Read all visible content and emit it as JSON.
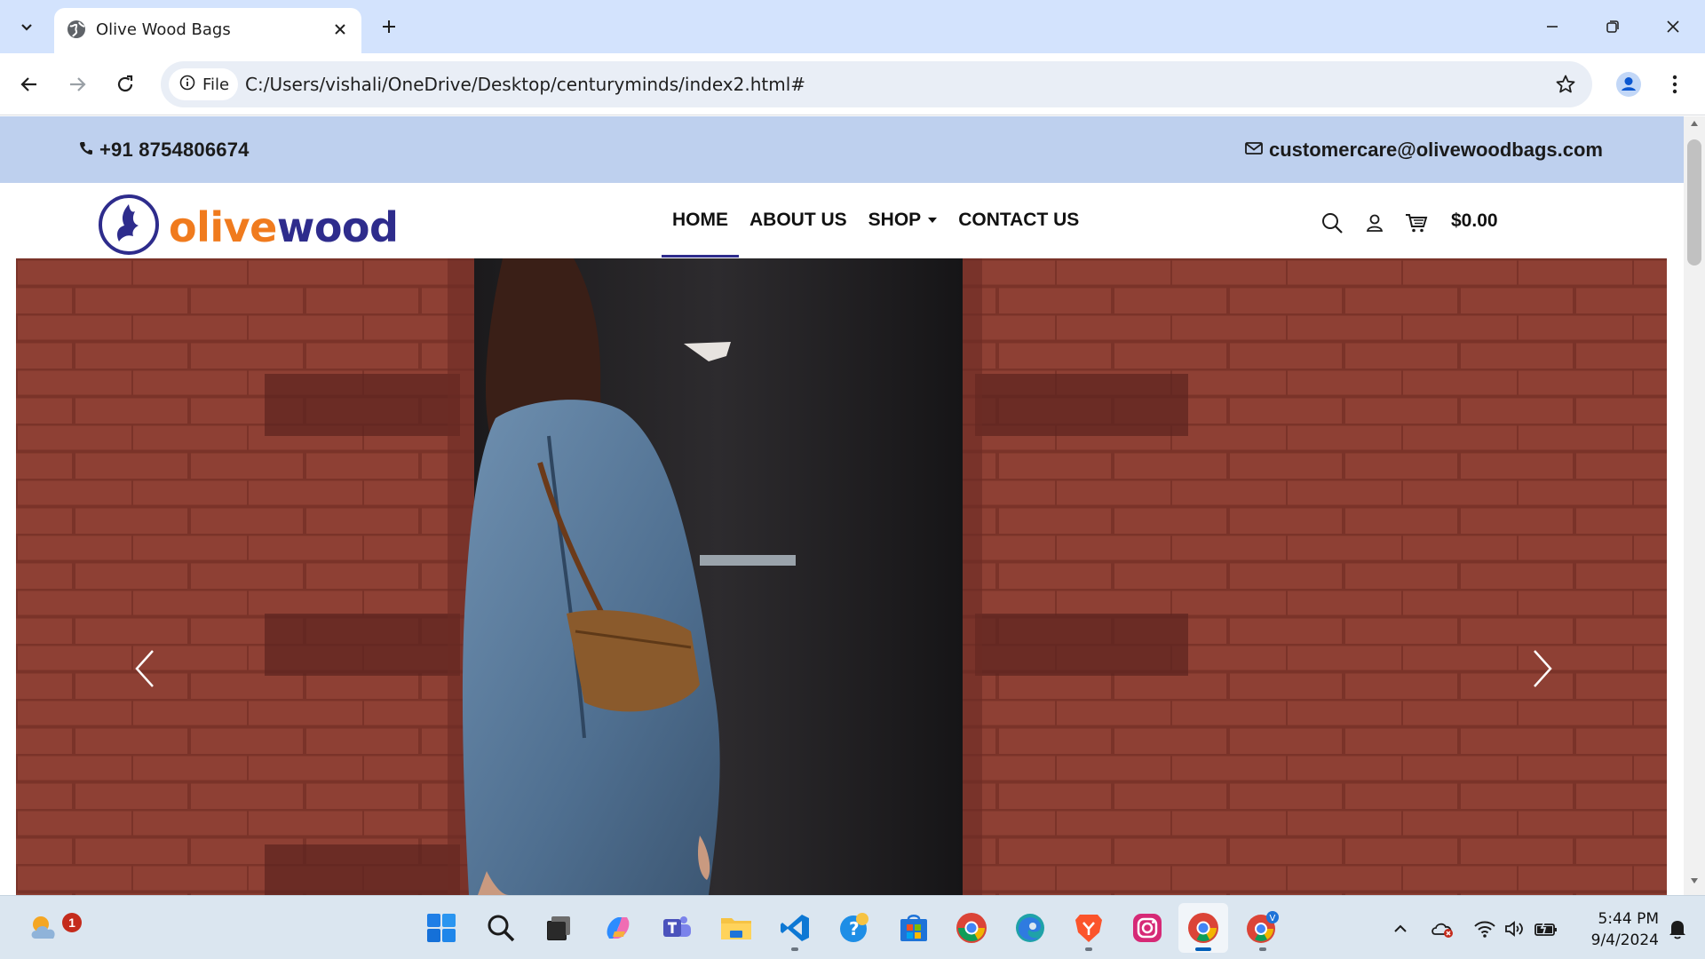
{
  "browser": {
    "tab_title": "Olive Wood Bags",
    "site_chip": "File",
    "url": "C:/Users/vishali/OneDrive/Desktop/centuryminds/index2.html#"
  },
  "page": {
    "topbar": {
      "phone": "+91 8754806674",
      "email": "customercare@olivewoodbags.com"
    },
    "logo": {
      "part1": "olive",
      "part2": "wood"
    },
    "nav": [
      {
        "label": "HOME",
        "active": true
      },
      {
        "label": "ABOUT US"
      },
      {
        "label": "SHOP",
        "dropdown": true
      },
      {
        "label": "CONTACT US"
      }
    ],
    "cart_total": "$0.00"
  },
  "taskbar": {
    "weather_badge": "1",
    "time": "5:44 PM",
    "date": "9/4/2024"
  },
  "colors": {
    "brand_orange": "#f07b1e",
    "brand_navy": "#2e2c8c",
    "topbar_bg": "#bed0ee",
    "tabstrip_bg": "#d3e3fd"
  }
}
